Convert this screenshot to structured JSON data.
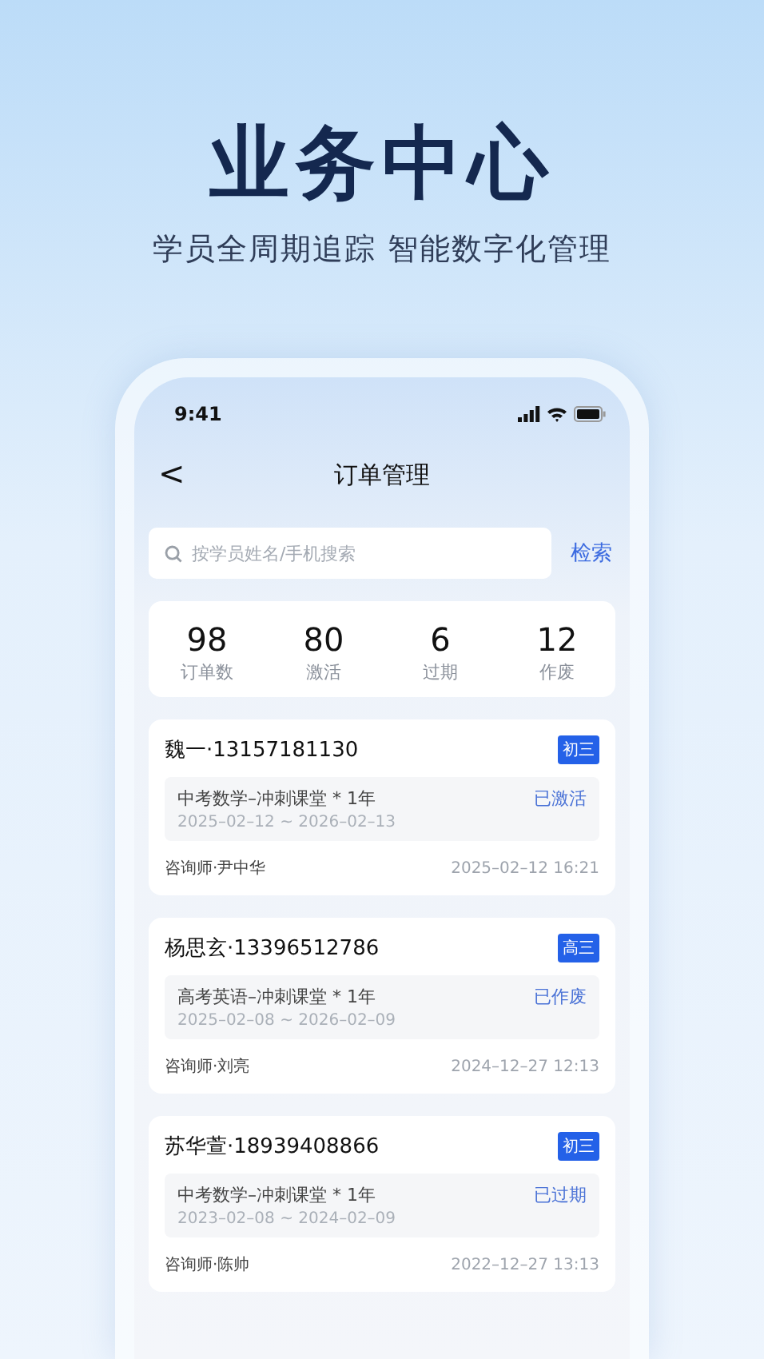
{
  "headline": "业务中心",
  "tagline": "学员全周期追踪 智能数字化管理",
  "phone": {
    "status_bar": {
      "time": "9:41"
    },
    "nav": {
      "back": "<",
      "title": "订单管理"
    },
    "search": {
      "placeholder": "按学员姓名/手机搜索",
      "button": "检索"
    },
    "stats": [
      {
        "value": "98",
        "label": "订单数"
      },
      {
        "value": "80",
        "label": "激活"
      },
      {
        "value": "6",
        "label": "过期"
      },
      {
        "value": "12",
        "label": "作废"
      }
    ],
    "orders": [
      {
        "student": "魏一·13157181130",
        "grade": "初三",
        "course": "中考数学–冲刺课堂 * 1年",
        "period": "2025–02–12 ~ 2026–02–13",
        "status": "已激活",
        "consultant": "咨询师·尹中华",
        "time": "2025–02–12 16:21"
      },
      {
        "student": "杨思玄·13396512786",
        "grade": "高三",
        "course": "高考英语–冲刺课堂 * 1年",
        "period": "2025–02–08 ~ 2026–02–09",
        "status": "已作废",
        "consultant": "咨询师·刘亮",
        "time": "2024–12–27 12:13"
      },
      {
        "student": "苏华萱·18939408866",
        "grade": "初三",
        "course": "中考数学–冲刺课堂 * 1年",
        "period": "2023–02–08 ~ 2024–02–09",
        "status": "已过期",
        "consultant": "咨询师·陈帅",
        "time": "2022–12–27 13:13"
      }
    ]
  }
}
